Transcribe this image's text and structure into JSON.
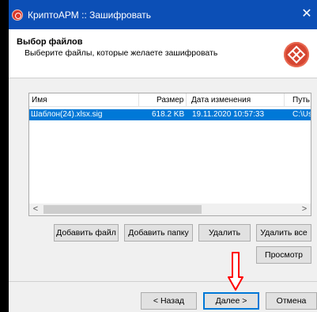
{
  "window": {
    "title": "КриптоАРМ :: Зашифровать",
    "close": "✕"
  },
  "header": {
    "title": "Выбор файлов",
    "subtitle": "Выберите файлы, которые желаете зашифровать"
  },
  "file_list": {
    "columns": [
      "Имя",
      "Размер",
      "Дата изменения",
      "Путь"
    ],
    "rows": [
      {
        "name": "Шаблон(24).xlsx.sig",
        "size": "618.2 KB",
        "modified": "19.11.2020 10:57:33",
        "path": "C:\\Us"
      }
    ]
  },
  "scrollbar": {
    "left": "<",
    "right": ">"
  },
  "buttons": {
    "add_file": "Добавить файл",
    "add_folder": "Добавить папку",
    "delete": "Удалить",
    "delete_all": "Удалить все",
    "view": "Просмотр"
  },
  "nav": {
    "back": "< Назад",
    "next": "Далее >",
    "cancel": "Отмена"
  },
  "colors": {
    "titlebar": "#0c4fb6",
    "selection": "#0078d7",
    "annotation_arrow": "#ff0000"
  }
}
